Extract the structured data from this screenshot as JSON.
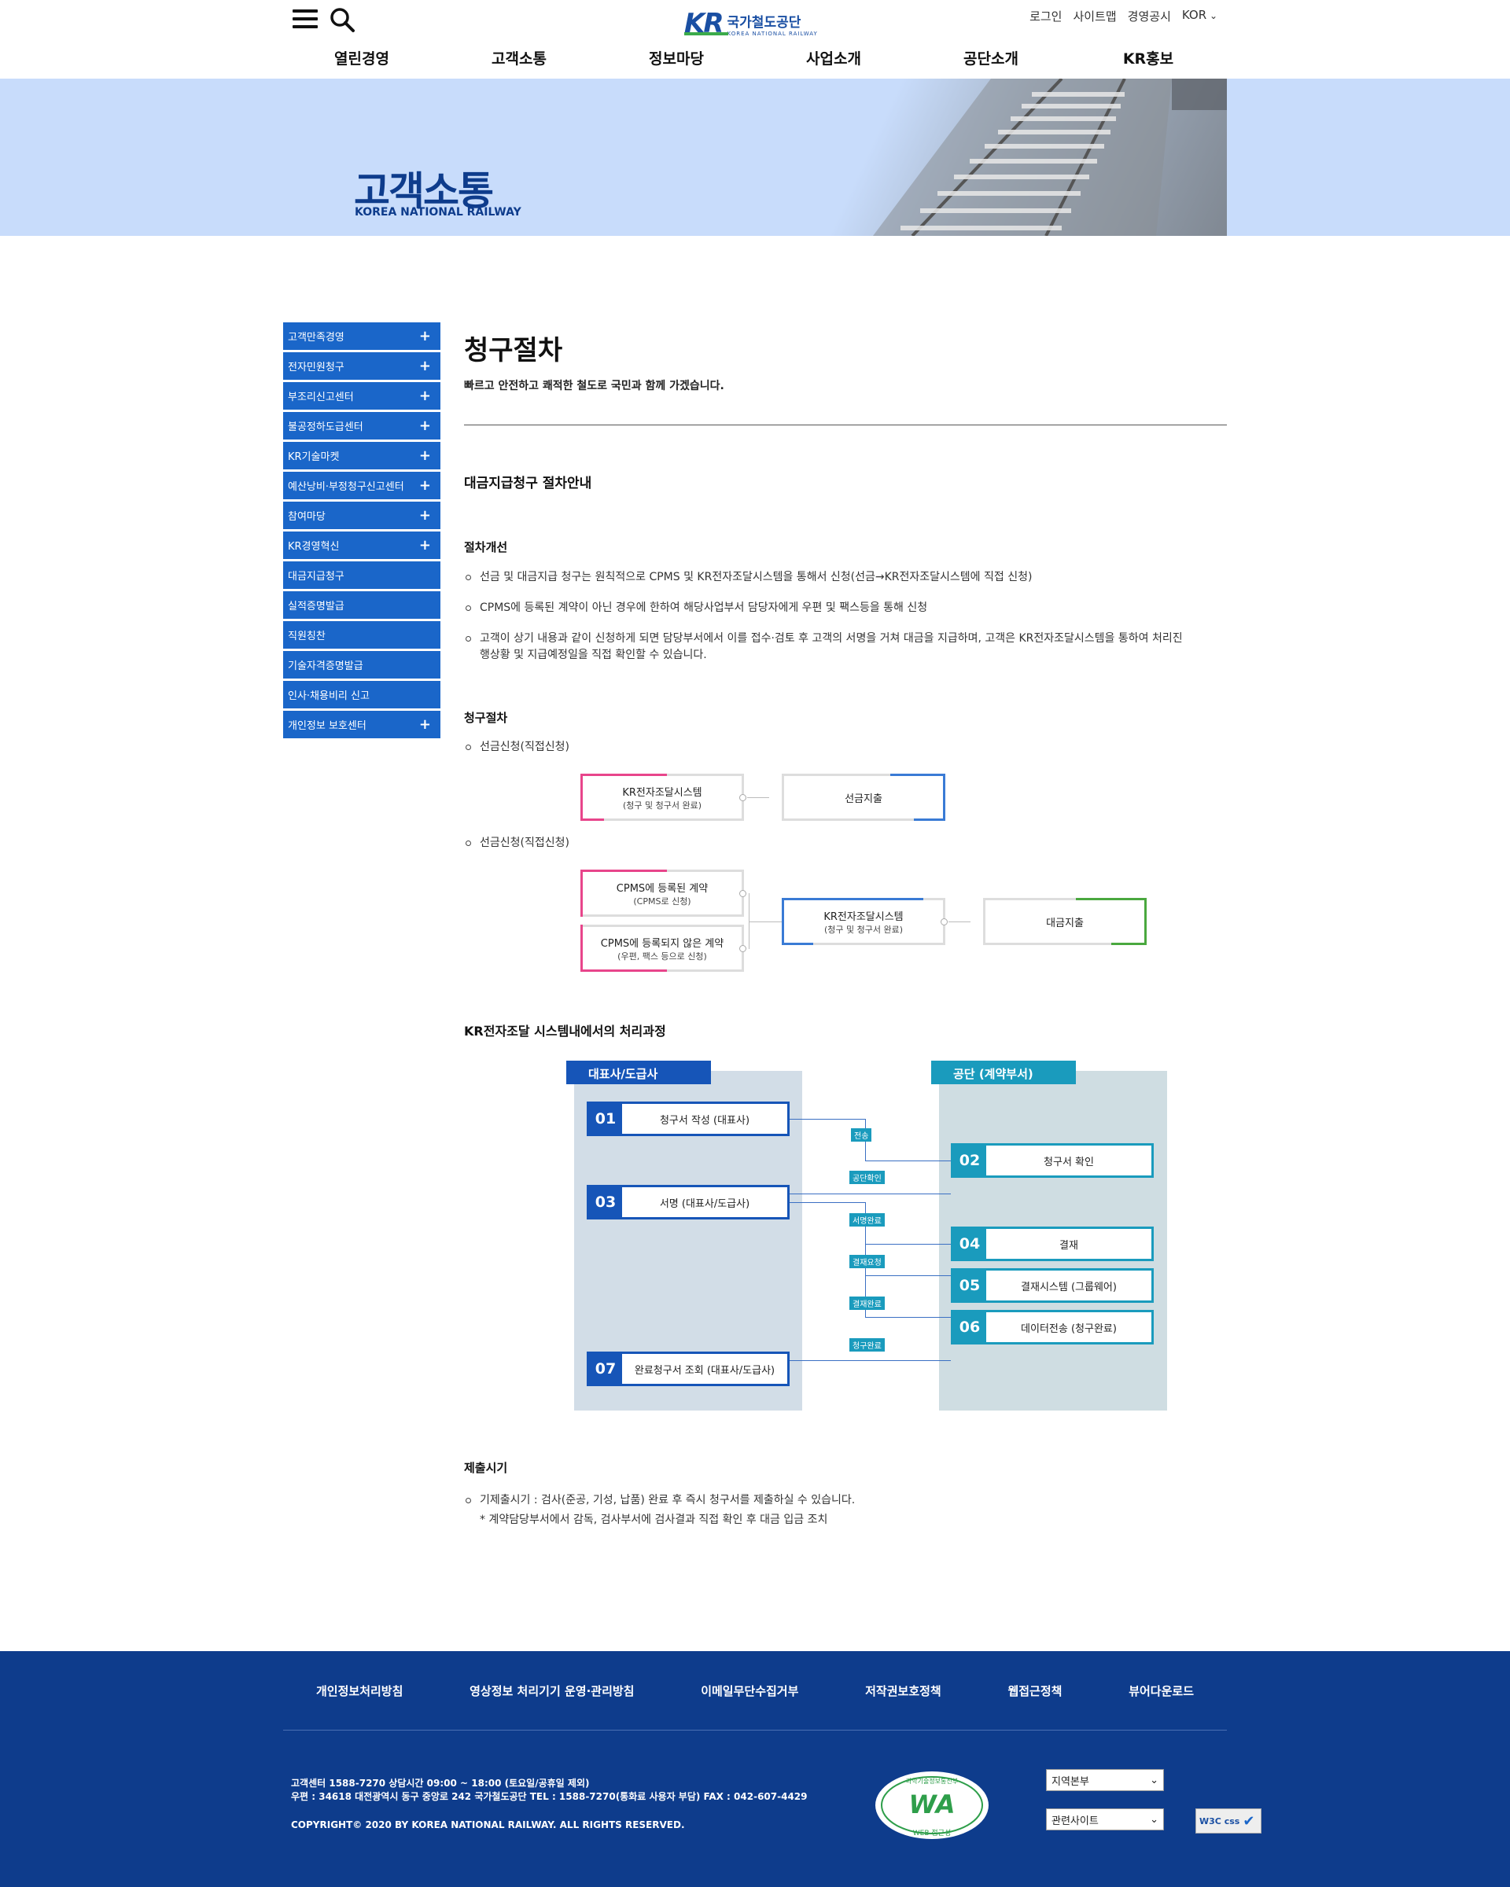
{
  "header": {
    "logo_ko": "국가철도공단",
    "logo_en": "KOREA NATIONAL RAILWAY",
    "logo_mark": "KR",
    "util": {
      "login": "로그인",
      "sitemap": "사이트맵",
      "disclosure": "경영공시",
      "lang": "KOR"
    },
    "gnb": [
      "열린경영",
      "고객소통",
      "정보마당",
      "사업소개",
      "공단소개",
      "KR홍보"
    ]
  },
  "banner": {
    "title": "고객소통",
    "subtitle": "KOREA NATIONAL RAILWAY"
  },
  "lnb": [
    {
      "label": "고객만족경영",
      "plus": true
    },
    {
      "label": "전자민원청구",
      "plus": true
    },
    {
      "label": "부조리신고센터",
      "plus": true
    },
    {
      "label": "불공정하도급센터",
      "plus": true
    },
    {
      "label": "KR기술마켓",
      "plus": true
    },
    {
      "label": "예산낭비·부정청구신고센터",
      "plus": true
    },
    {
      "label": "참여마당",
      "plus": true
    },
    {
      "label": "KR경영혁신",
      "plus": true
    },
    {
      "label": "대금지급청구",
      "plus": false
    },
    {
      "label": "실적증명발급",
      "plus": false
    },
    {
      "label": "직원칭찬",
      "plus": false
    },
    {
      "label": "기술자격증명발급",
      "plus": false
    },
    {
      "label": "인사·채용비리 신고",
      "plus": false
    },
    {
      "label": "개인정보 보호센터",
      "plus": true
    }
  ],
  "plus_glyph": "+",
  "content": {
    "title": "청구절차",
    "desc": "빠르고 안전하고 쾌적한 철도로 국민과 함께 가겠습니다.",
    "section1": "대금지급청구 절차안내",
    "improve_title": "절차개선",
    "improve_items": [
      "선금 및 대금지급 청구는 원칙적으로 CPMS 및 KR전자조달시스템을 통해서 신청(선금→KR전자조달시스템에 직접 신청)",
      "CPMS에 등록된 계약이 아닌 경우에 한하여 해당사업부서 담당자에게 우편 및 팩스등을 통해 신청",
      "고객이 상기 내용과 같이 신청하게 되면 담당부서에서 이를 접수·검토 후 고객의 서명을 거쳐 대금을 지급하며, 고객은 KR전자조달시스템을 통하여 처리진",
      "행상황 및 지급예정일을 직접 확인할 수 있습니다."
    ],
    "claim_title": "청구절차",
    "flow1_label": "선금신청(직접신청)",
    "flow1": {
      "box1": "KR전자조달시스템",
      "box1_sub": "(청구 및 청구서 완료)",
      "box2": "선금지출"
    },
    "flow2_label": "선금신청(직접신청)",
    "flow2": {
      "box1": "CPMS에 등록된 계약",
      "box1_sub": "(CPMS로 신청)",
      "box2": "CPMS에 등록되지 않은 계약",
      "box2_sub": "(우편, 팩스 등으로 신청)",
      "box3": "KR전자조달시스템",
      "box3_sub": "(청구 및 청구서 완료)",
      "box4": "대금지출"
    },
    "process_title": "KR전자조달 시스템내에서의 처리과정",
    "process": {
      "left_header": "대표사/도급사",
      "right_header": "공단 (계약부서)",
      "steps": [
        {
          "num": "01",
          "label": "청구서 작성 (대표사)"
        },
        {
          "num": "02",
          "label": "청구서 확인"
        },
        {
          "num": "03",
          "label": "서명 (대표사/도급사)"
        },
        {
          "num": "04",
          "label": "결재"
        },
        {
          "num": "05",
          "label": "결재시스템 (그룹웨어)"
        },
        {
          "num": "06",
          "label": "데이터전송 (청구완료)"
        },
        {
          "num": "07",
          "label": "완료청구서 조회 (대표사/도급사)"
        }
      ],
      "tags": [
        "전송",
        "공단확인",
        "서명완료",
        "결재요청",
        "결재완료",
        "청구완료"
      ]
    },
    "submit_title": "제출시기",
    "submit_item": "기제출시기 : 검사(준공, 기성, 납품) 완료 후 즉시 청구서를 제출하실 수 있습니다.",
    "submit_note": "* 계약담당부서에서 감독, 검사부서에 검사결과 직접 확인 후 대금 입금 조치"
  },
  "footer": {
    "links": [
      "개인정보처리방침",
      "영상정보 처리기기 운영·관리방침",
      "이메일무단수집거부",
      "저작권보호정책",
      "웹접근정책",
      "뷰어다운로드"
    ],
    "info1": "고객센터 1588-7270 상담시간 09:00 ~ 18:00 (토요일/공휴일 제외)",
    "info2": "우편 : 34618 대전광역시 동구 중앙로 242 국가철도공단 TEL : 1588-7270(통화료 사용자 부담) FAX : 042-607-4429",
    "copyright": "COPYRIGHT© 2020 BY KOREA NATIONAL RAILWAY. ALL RIGHTS RESERVED.",
    "wa_text": "WA",
    "wa_top": "과학기술정보통신부",
    "wa_bottom": "WEB 접근성",
    "select1": "지역본부",
    "select2": "관련사이트",
    "w3c": "W3C css"
  },
  "colors": {
    "primary": "#1a66c9",
    "navy": "#0e3c8c",
    "banner": "#c8dcfb",
    "pink": "#e8458b",
    "blue": "#3a7bd5",
    "green": "#4aa83f",
    "teal": "#1a9bbd"
  }
}
